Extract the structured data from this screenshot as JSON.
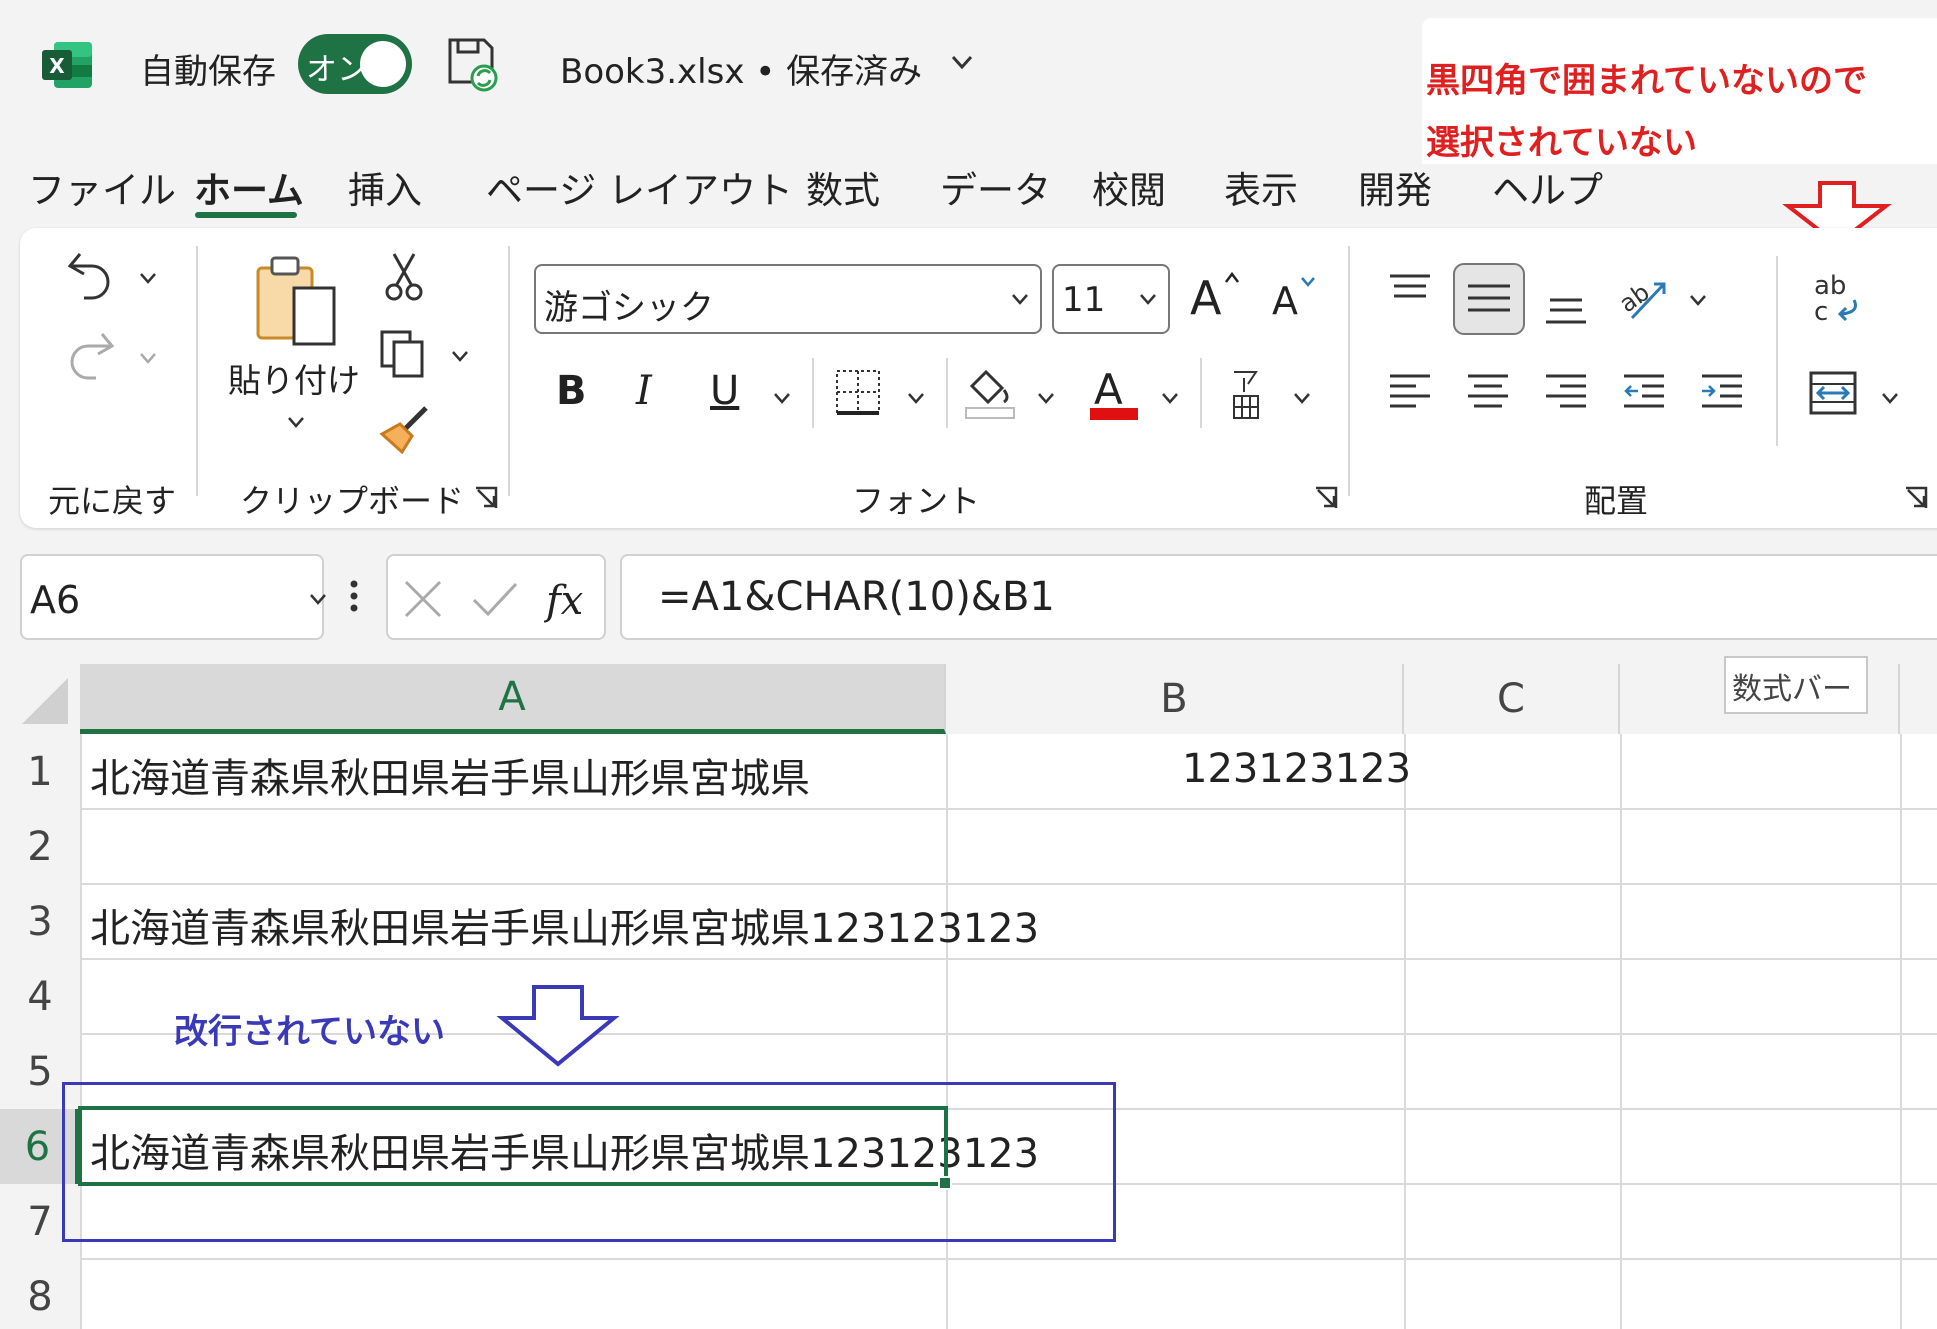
{
  "app": {
    "autosave_label": "自動保存",
    "autosave_state": "オン",
    "doc_title": "Book3.xlsx • 保存済み",
    "accent": "#1f7244"
  },
  "callouts": {
    "red_note_line1": "黒四角で囲まれていないので",
    "red_note_line2": "選択されていない",
    "formula_bar_label": "数式バー",
    "blue_note": "改行されていない",
    "red_color": "#e02020",
    "blue_color": "#3a3ab8"
  },
  "tabs": [
    {
      "label": "ファイル"
    },
    {
      "label": "ホーム"
    },
    {
      "label": "挿入"
    },
    {
      "label": "ページ レイアウト"
    },
    {
      "label": "数式"
    },
    {
      "label": "データ"
    },
    {
      "label": "校閲"
    },
    {
      "label": "表示"
    },
    {
      "label": "開発"
    },
    {
      "label": "ヘルプ"
    }
  ],
  "ribbon": {
    "groups": {
      "undo": "元に戻す",
      "clipboard": "クリップボード",
      "font": "フォント",
      "alignment": "配置"
    },
    "paste_label": "貼り付け",
    "font_name": "游ゴシック",
    "font_size": "11",
    "bold": "B",
    "italic": "I",
    "underline": "U"
  },
  "formula_bar": {
    "name_box": "A6",
    "formula": "=A1&CHAR(10)&B1"
  },
  "grid": {
    "columns": [
      "A",
      "B",
      "C"
    ],
    "rows": [
      "1",
      "2",
      "3",
      "4",
      "5",
      "6",
      "7",
      "8"
    ],
    "A1": "北海道青森県秋田県岩手県山形県宮城県",
    "B1": "123123123",
    "A3": "北海道青森県秋田県岩手県山形県宮城県123123123",
    "A6": "北海道青森県秋田県岩手県山形県宮城県123123123"
  }
}
